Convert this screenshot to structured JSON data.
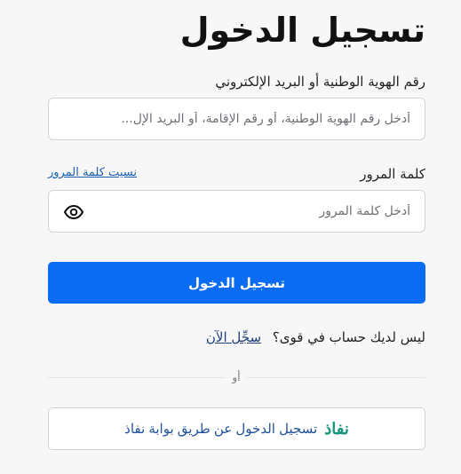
{
  "page_title": "تسجيل الدخول",
  "id_field": {
    "label": "رقم الهوية الوطنية أو البريد الإلكتروني",
    "placeholder": "أدخل رقم الهوية الوطنية، أو رقم الإقامة، أو البريد الإل...",
    "value": ""
  },
  "password_field": {
    "label": "كلمة المرور",
    "forgot_link": "نسيت كلمة المرور",
    "placeholder": "أدخل كلمة المرور",
    "value": "",
    "toggle_icon": "eye-icon"
  },
  "login_button": "تسجيل الدخول",
  "signup": {
    "prompt": "ليس لديك حساب في قوى؟",
    "link": "سجِّل الآن"
  },
  "divider_text": "أو",
  "nafath": {
    "logo_text": "نفاذ",
    "label": "تسجيل الدخول عن طريق بوابة نفاذ"
  },
  "colors": {
    "primary": "#0a6cf2",
    "link": "#1d5fb0",
    "nafath_green": "#13967a",
    "background": "#f7f7f8"
  }
}
